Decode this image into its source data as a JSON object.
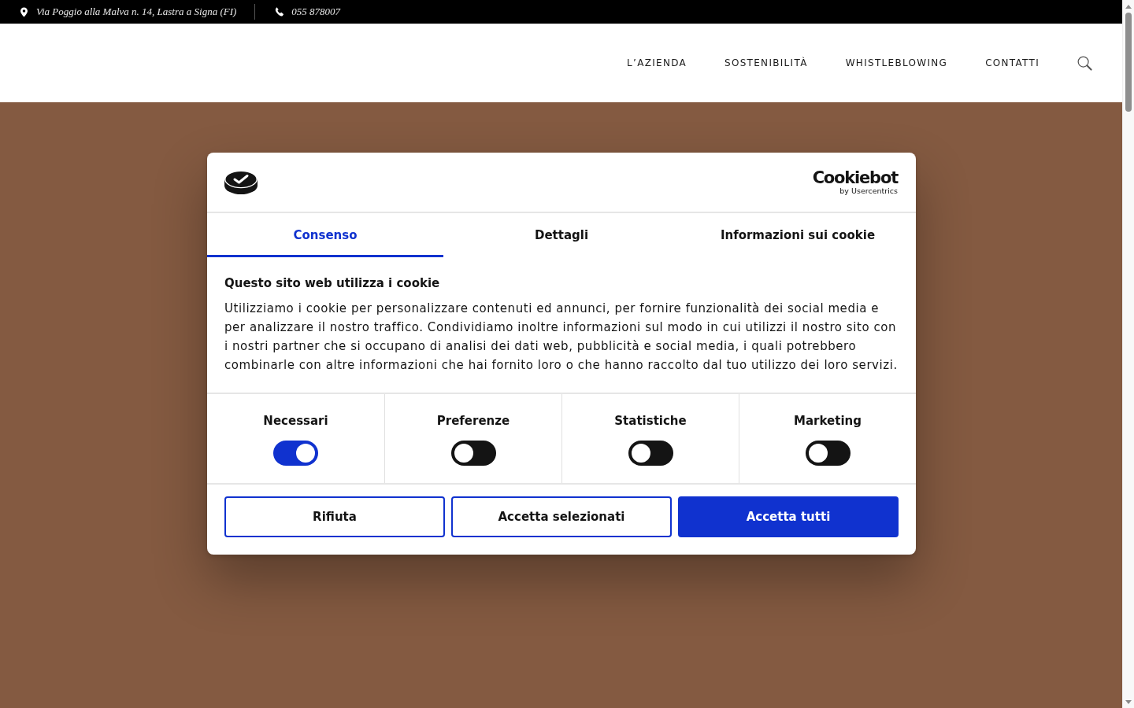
{
  "top_bar": {
    "address": "Via Poggio alla Malva n. 14, Lastra a Signa (FI)",
    "phone": "055 878007"
  },
  "nav": {
    "items": [
      {
        "label": "L’AZIENDA"
      },
      {
        "label": "SOSTENIBILITÀ"
      },
      {
        "label": "WHISTLEBLOWING"
      },
      {
        "label": "CONTATTI"
      }
    ]
  },
  "cookie_dialog": {
    "brand": {
      "name": "Cookiebot",
      "tagline": "by Usercentrics"
    },
    "tabs": [
      {
        "label": "Consenso",
        "selected": true
      },
      {
        "label": "Dettagli",
        "selected": false
      },
      {
        "label": "Informazioni sui cookie",
        "selected": false
      }
    ],
    "title": "Questo sito web utilizza i cookie",
    "text": "Utilizziamo i cookie per personalizzare contenuti ed annunci, per fornire funzionalità dei social media e per analizzare il nostro traffico. Condividiamo inoltre informazioni sul modo in cui utilizzi il nostro sito con i nostri partner che si occupano di analisi dei dati web, pubblicità e social media, i quali potrebbero combinarle con altre informazioni che hai fornito loro o che hanno raccolto dal tuo utilizzo dei loro servizi.",
    "categories": [
      {
        "label": "Necessari",
        "on": true
      },
      {
        "label": "Preferenze",
        "on": false
      },
      {
        "label": "Statistiche",
        "on": false
      },
      {
        "label": "Marketing",
        "on": false
      }
    ],
    "buttons": [
      {
        "label": "Rifiuta",
        "kind": "outline"
      },
      {
        "label": "Accetta selezionati",
        "kind": "outline"
      },
      {
        "label": "Accetta tutti",
        "kind": "primary"
      }
    ]
  }
}
